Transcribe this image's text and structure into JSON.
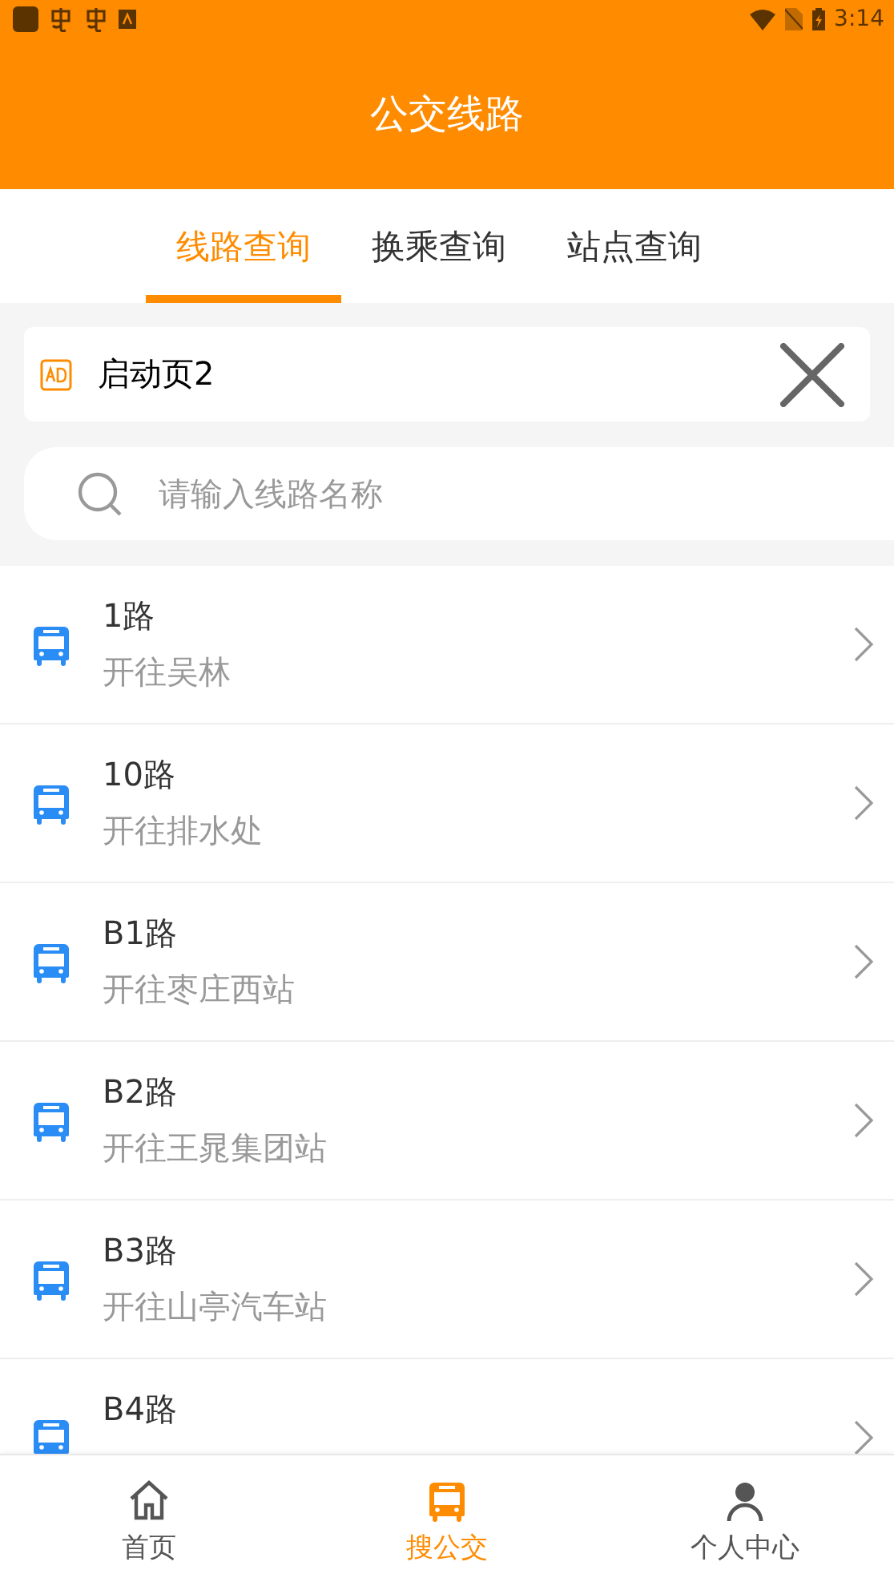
{
  "status_bar": {
    "time": "3:14"
  },
  "header": {
    "title": "公交线路"
  },
  "tabs": [
    {
      "label": "线路查询",
      "selected": true
    },
    {
      "label": "换乘查询",
      "selected": false
    },
    {
      "label": "站点查询",
      "selected": false
    }
  ],
  "ad": {
    "text": "启动页2"
  },
  "search": {
    "placeholder": "请输入线路名称"
  },
  "routes": [
    {
      "name": "1路",
      "destination": "开往吴林"
    },
    {
      "name": "10路",
      "destination": "开往排水处"
    },
    {
      "name": "B1路",
      "destination": "开往枣庄西站"
    },
    {
      "name": "B2路",
      "destination": "开往王晁集团站"
    },
    {
      "name": "B3路",
      "destination": "开往山亭汽车站"
    },
    {
      "name": "B4路"
    }
  ],
  "nav": [
    {
      "label": "首页",
      "kind": "home",
      "selected": false
    },
    {
      "label": "搜公交",
      "kind": "bus",
      "selected": true
    },
    {
      "label": "个人中心",
      "kind": "person",
      "selected": false
    }
  ]
}
